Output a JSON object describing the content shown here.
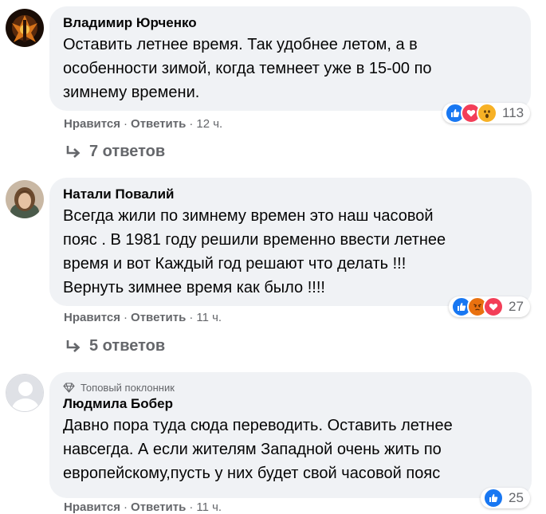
{
  "comments": [
    {
      "author": "Владимир Юрченко",
      "lines": [
        "Оставить летнее время. Так удобнее летом, а в",
        "особенности зимой, когда темнеет уже в 15-00 по",
        "зимнему времени."
      ],
      "reactions": [
        "like",
        "love",
        "wow"
      ],
      "reaction_count": "113",
      "like_label": "Нравится",
      "reply_label": "Ответить",
      "time": "12 ч.",
      "replies": "7 ответов"
    },
    {
      "author": "Натали Повалий",
      "lines": [
        "Всегда жили по зимнему времен это наш часовой",
        "пояс . В 1981 году решили временно ввести летнее",
        "время и вот Каждый год решают что делать !!!",
        "Вернуть зимнее время как было !!!!"
      ],
      "reactions": [
        "like",
        "angry",
        "love"
      ],
      "reaction_count": "27",
      "like_label": "Нравится",
      "reply_label": "Ответить",
      "time": "11 ч.",
      "replies": "5 ответов"
    },
    {
      "badge": "Топовый поклонник",
      "author": "Людмила Бобер",
      "lines": [
        "Давно пора туда сюда переводить. Оставить летнее",
        "навсегда. А если жителям Западной очень жить по",
        "европейскому,пусть у них будет свой часовой пояс"
      ],
      "reactions": [
        "like"
      ],
      "reaction_count": "25",
      "like_label": "Нравится",
      "reply_label": "Ответить",
      "time": "11 ч."
    }
  ],
  "separator": "·",
  "colors": {
    "bubble": "#f0f2f5",
    "meta": "#65676b",
    "like": "#1877f2",
    "love": "#f33e58",
    "wow": "#f7b125",
    "angry": "#e9710f"
  }
}
